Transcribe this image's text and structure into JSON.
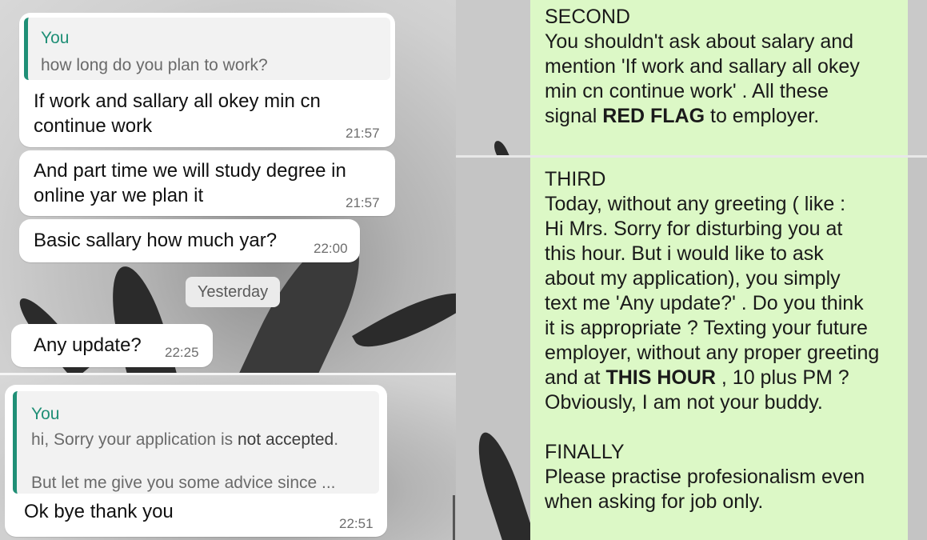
{
  "left_top": {
    "quote": {
      "name": "You",
      "text": "how long do you plan to work?"
    },
    "messages": [
      {
        "line1": "If work and sallary all okey min cn",
        "line2": "continue work",
        "time": "21:57"
      },
      {
        "line1": "And part time we will study degree in",
        "line2": "online yar we plan it",
        "time": "21:57"
      },
      {
        "line1": "Basic sallary how much yar?",
        "time": "22:00"
      }
    ],
    "date_chip": "Yesterday",
    "last": {
      "text": "Any update?",
      "time": "22:25"
    }
  },
  "left_bottom": {
    "quote": {
      "name": "You",
      "line1_pre": "hi, Sorry your application is ",
      "line1_bold": "not accepted",
      "line1_post": ".",
      "line2": "But let me give you some advice since ..."
    },
    "reply": {
      "text": "Ok bye thank you",
      "time": "22:51"
    }
  },
  "right_top": {
    "heading": "SECOND",
    "lines": [
      "You shouldn't ask about salary and",
      "mention 'If work and sallary all okey",
      "min cn continue work' . All these"
    ],
    "last_pre": "signal ",
    "last_bold": "RED FLAG",
    "last_post": " to employer."
  },
  "right_bottom": {
    "third_heading": "THIRD",
    "third_lines": [
      "Today, without any greeting ( like :",
      "Hi Mrs. Sorry for disturbing you at",
      "this hour. But i would like to ask",
      "about my application), you simply",
      "text me 'Any update?' . Do you think",
      "it is appropriate ? Texting your future",
      "employer, without any proper greeting"
    ],
    "hour_pre": "and at ",
    "hour_bold": "THIS HOUR",
    "hour_post": " , 10 plus PM ?",
    "buddy_line": "Obviously, I am not your buddy.",
    "final_heading": "FINALLY",
    "final_lines": [
      "Please practise profesionalism even",
      "when asking for job only."
    ]
  }
}
